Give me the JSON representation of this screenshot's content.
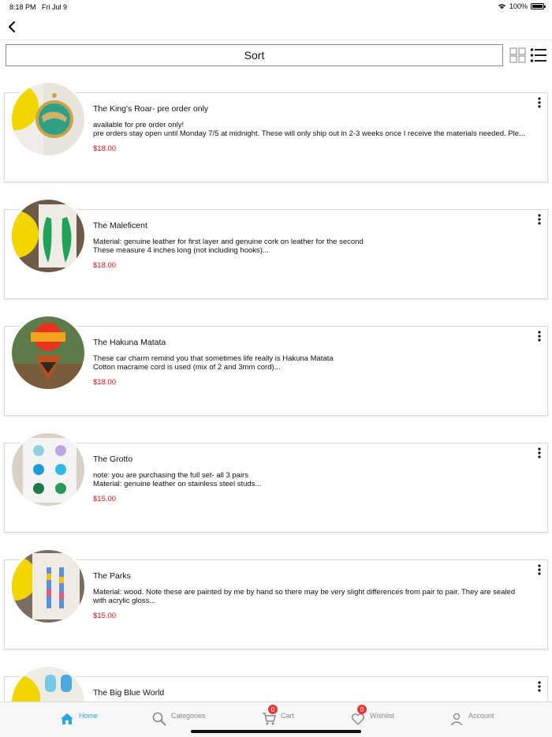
{
  "status": {
    "time": "8:18 PM",
    "date": "Fri Jul 9",
    "battery": "100%"
  },
  "sort": {
    "label": "Sort"
  },
  "products": [
    {
      "title": "The King's Roar- pre order only",
      "lines": [
        "available for pre order only!",
        "pre orders stay open until Monday 7/5 at midnight. These will only ship out in 2-3 weeks once I receive the materials needed. Ple..."
      ],
      "price": "$18.00"
    },
    {
      "title": "The Maleficent",
      "lines": [
        "Material: genuine leather for first layer and genuine cork on leather for the second",
        "These measure 4 inches long (not including hooks)..."
      ],
      "price": "$18.00"
    },
    {
      "title": "The Hakuna Matata",
      "lines": [
        "These car charm remind you that sometimes life really is Hakuna Matata",
        "Cotton macrame cord is used (mix of 2 and 3mm cord)..."
      ],
      "price": "$18.00"
    },
    {
      "title": "The Grotto",
      "lines": [
        "note: you are purchasing the full set- all 3 pairs",
        "Material: genuine leather on stainless steel  studs..."
      ],
      "price": "$15.00"
    },
    {
      "title": "The Parks",
      "lines": [
        "Material: wood. Note these are painted by me by hand so there may be very slight differences from pair to pair. They are sealed",
        "with acrylic gloss..."
      ],
      "price": "$15.00"
    },
    {
      "title": "The Big Blue World",
      "lines": [],
      "price": ""
    }
  ],
  "tabs": [
    {
      "label": "Home",
      "icon": "home-icon",
      "active": true
    },
    {
      "label": "Categories",
      "icon": "search-icon",
      "active": false
    },
    {
      "label": "Cart",
      "icon": "cart-icon",
      "badge": "0",
      "active": false
    },
    {
      "label": "Wishlist",
      "icon": "heart-icon",
      "badge": "0",
      "active": false
    },
    {
      "label": "Account",
      "icon": "user-icon",
      "active": false
    }
  ],
  "colors": {
    "accent": "#2ba6e0",
    "price": "#e01010",
    "badge": "#e53935"
  }
}
